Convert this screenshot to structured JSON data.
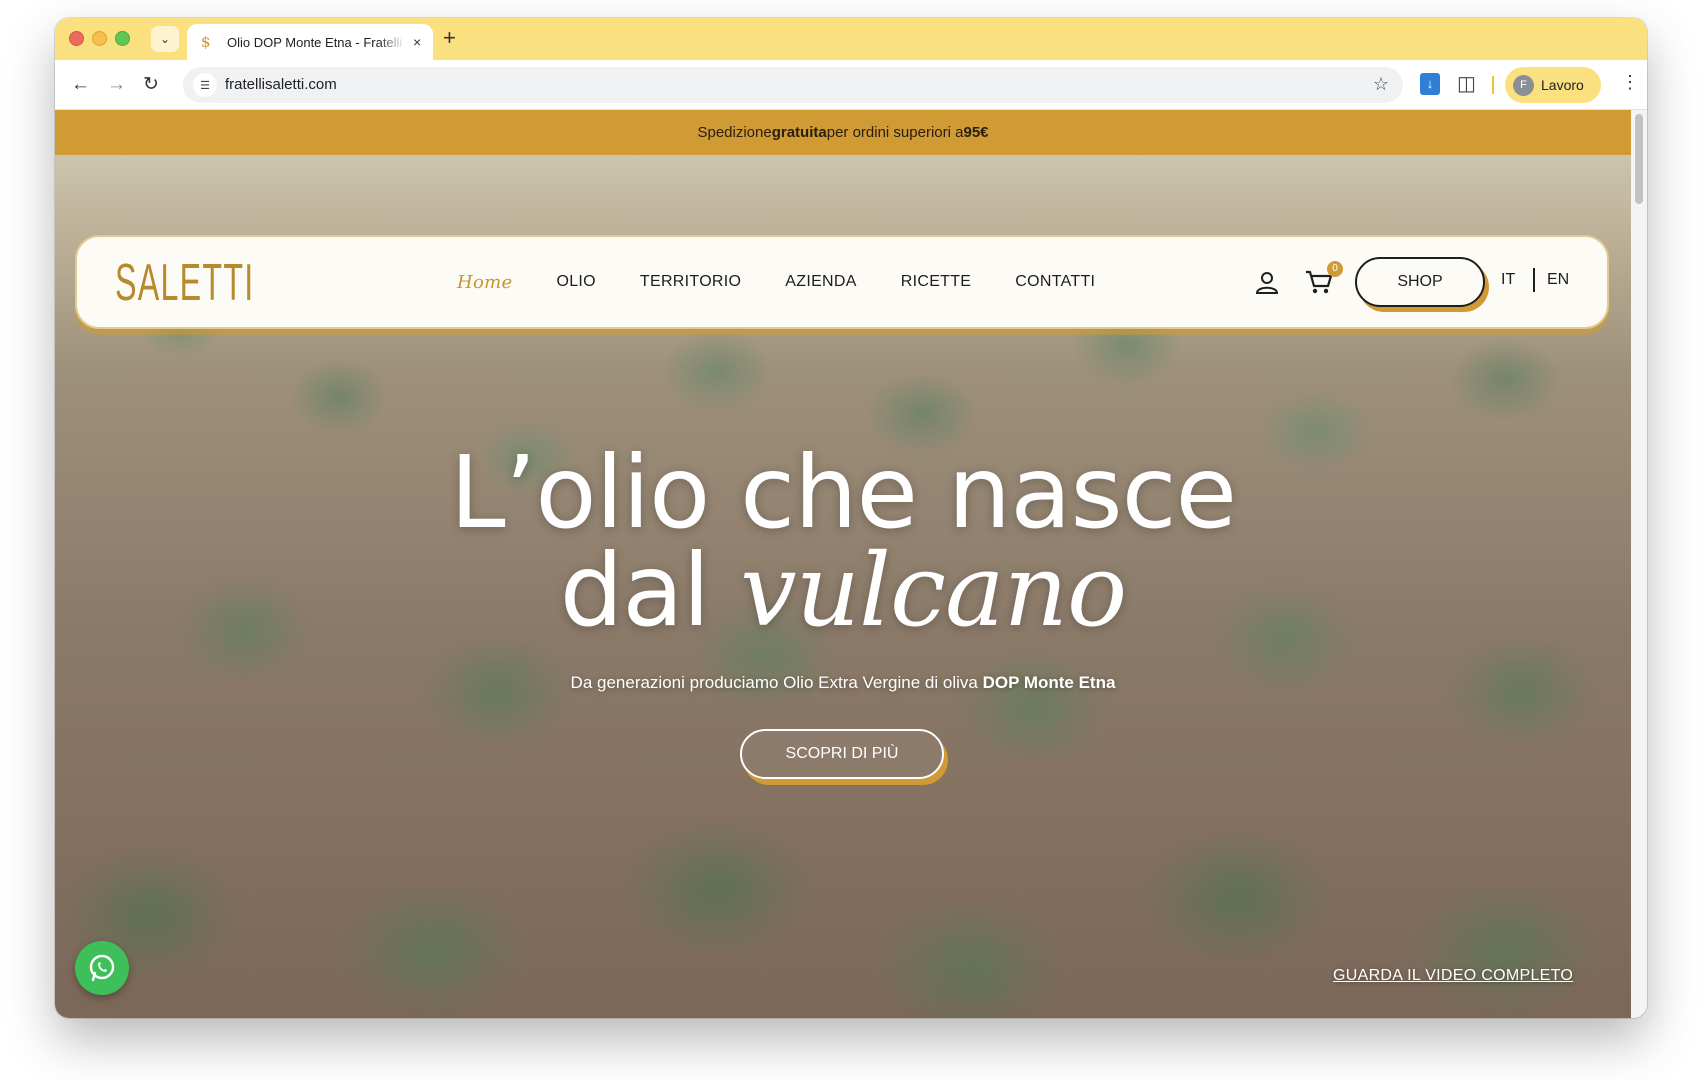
{
  "browser": {
    "tab": {
      "favicon": "$",
      "title": "Olio DOP Monte Etna - Fratelli Saletti",
      "close": "×"
    },
    "new_tab": "+",
    "tab_menu": "⌄",
    "url": "fratellisaletti.com",
    "profile": {
      "initial": "F",
      "label": "Lavoro"
    },
    "icons": [
      "back-icon",
      "forward-icon",
      "reload-icon",
      "site-info-icon",
      "star-icon",
      "download-icon",
      "extensions-icon",
      "menu-icon"
    ]
  },
  "promo": {
    "prefix": "Spedizione ",
    "bold": "gratuita",
    "middle": " per ordini superiori a ",
    "amount": "95€"
  },
  "header": {
    "logo": "SALETTI",
    "nav": [
      "Home",
      "OLIO",
      "TERRITORIO",
      "AZIENDA",
      "RICETTE",
      "CONTATTI"
    ],
    "cart_count": "0",
    "shop_label": "SHOP",
    "lang": [
      "IT",
      "EN"
    ]
  },
  "hero": {
    "line1": "L’olio che nasce",
    "line2_plain": "dal ",
    "line2_accent": "vulcano",
    "subtitle_plain": "Da generazioni produciamo Olio Extra Vergine di oliva ",
    "subtitle_bold": "DOP Monte Etna",
    "cta": "SCOPRI DI PIÙ",
    "video_link": "GUARDA IL VIDEO COMPLETO"
  },
  "colors": {
    "accent": "#d09a35",
    "tabstrip": "#fbe07f",
    "logo": "#b68a2d",
    "whatsapp": "#3fbf5a"
  }
}
